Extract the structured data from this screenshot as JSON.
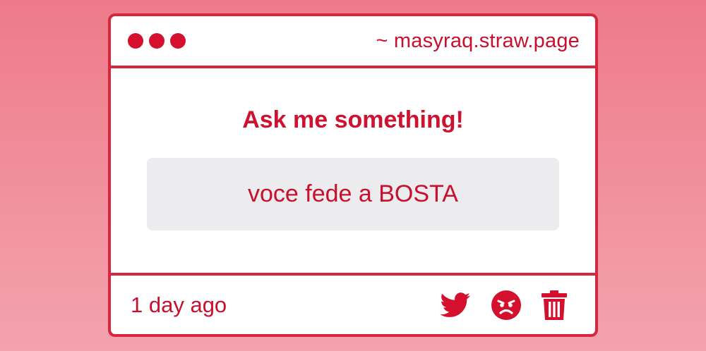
{
  "window": {
    "url": "~ masyraq.straw.page",
    "dots": [
      "dot",
      "dot",
      "dot"
    ]
  },
  "main": {
    "heading": "Ask me something!",
    "question": "voce fede a BOSTA"
  },
  "footer": {
    "timestamp": "1 day ago",
    "icons": [
      "twitter-icon",
      "angry-face-icon",
      "trash-icon"
    ]
  },
  "colors": {
    "accent": "#d9263f",
    "text": "#c8102e",
    "question_bg": "#ececee",
    "background_top": "#ee7a89",
    "background_bottom": "#f3a3ae"
  }
}
